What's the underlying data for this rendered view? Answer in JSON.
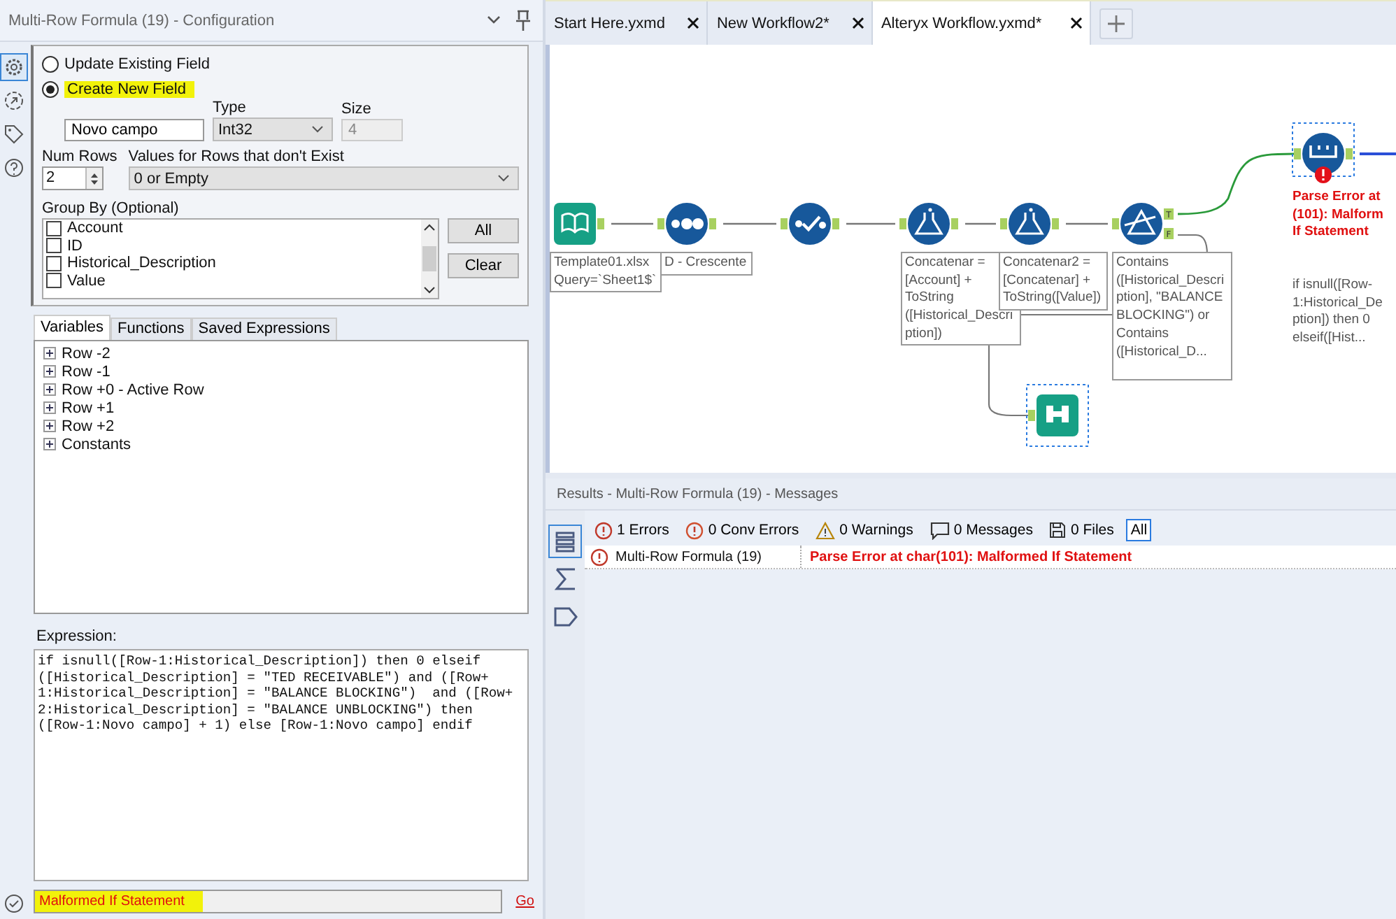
{
  "config_panel": {
    "title": "Multi-Row Formula (19) - Configuration",
    "side_icons": [
      {
        "kind": "settings",
        "selected": true
      },
      {
        "kind": "connection",
        "selected": false
      },
      {
        "kind": "tag",
        "selected": false
      },
      {
        "kind": "help",
        "selected": false
      }
    ],
    "field_mode": [
      {
        "label": "Update Existing Field",
        "selected": false,
        "highlighted": false
      },
      {
        "label": "Create New  Field",
        "selected": true,
        "highlighted": true
      }
    ],
    "new_field": {
      "value": "Novo campo",
      "type_label": "Type",
      "type_value": "Int32",
      "size_label": "Size",
      "size_value": "4"
    },
    "num_rows": {
      "label": "Num Rows",
      "value": "2"
    },
    "missing_rows": {
      "label": "Values for Rows that don't Exist",
      "value": "0 or Empty"
    },
    "group_by": {
      "label": "Group By (Optional)",
      "items": [
        {
          "label": "Account",
          "checked": false
        },
        {
          "label": "ID",
          "checked": false
        },
        {
          "label": "Historical_Description",
          "checked": false
        },
        {
          "label": "Value",
          "checked": false
        }
      ],
      "buttons": [
        "All",
        "Clear"
      ]
    },
    "expression_tabs": [
      {
        "label": "Variables",
        "selected": true
      },
      {
        "label": "Functions",
        "selected": false
      },
      {
        "label": "Saved Expressions",
        "selected": false
      }
    ],
    "variables": [
      {
        "label": "Row -2",
        "expanded": false
      },
      {
        "label": "Row -1",
        "expanded": false
      },
      {
        "label": "Row +0 - Active Row",
        "expanded": false
      },
      {
        "label": "Row +1",
        "expanded": false
      },
      {
        "label": "Row +2",
        "expanded": false
      },
      {
        "label": "Constants",
        "expanded": false
      }
    ],
    "expression": {
      "label": "Expression:",
      "lines": [
        "if isnull([Row-1:Historical_Description]) then 0 elseif",
        "([Historical_Description] = \"TED RECEIVABLE\") and ([Row+",
        "1:Historical_Description] = \"BALANCE BLOCKING\")  and ([Row+",
        "2:Historical_Description] = \"BALANCE UNBLOCKING\") then",
        "([Row-1:Novo campo] + 1) else [Row-1:Novo campo] endif"
      ]
    },
    "status": {
      "message": "Malformed If Statement",
      "highlighted": true,
      "link": "Go"
    }
  },
  "workflow_tabs": [
    {
      "label": "Start Here.yxmd",
      "selected": false
    },
    {
      "label": "New Workflow2*",
      "selected": false
    },
    {
      "label": "Alteryx Workflow.yxmd*",
      "selected": true
    }
  ],
  "canvas": {
    "nodes": [
      {
        "kind": "input",
        "selected": false,
        "error": false,
        "annotation": "Template01.xlsx\nQuery=`Sheet1$`"
      },
      {
        "kind": "record_id",
        "selected": false,
        "error": false,
        "annotation": "D - Crescente"
      },
      {
        "kind": "select",
        "selected": false,
        "error": false
      },
      {
        "kind": "formula",
        "selected": false,
        "error": false,
        "annotation": "Concatenar =\n[Account] +\nToString\n([Historical_Descri\nption])"
      },
      {
        "kind": "formula",
        "selected": false,
        "error": false,
        "annotation": "Concatenar2 =\n[Concatenar] +\nToString([Value])"
      },
      {
        "kind": "filter",
        "selected": false,
        "error": false,
        "outputs": [
          "T",
          "F"
        ],
        "annotation": "Contains\n([Historical_Descri\nption], \"BALANCE\nBLOCKING\") or\nContains\n([Historical_D..."
      },
      {
        "kind": "multi_row",
        "selected": true,
        "error": true,
        "error_text": "Parse Error at\n(101): Malform\nIf Statement",
        "annotation": "if isnull([Row-\n1:Historical_De\nption]) then 0\nelseif([Hist..."
      },
      {
        "kind": "browse",
        "selected": true,
        "error": false
      }
    ]
  },
  "results": {
    "title": "Results - Multi-Row Formula (19) - Messages",
    "side_icons": [
      {
        "kind": "list",
        "selected": true
      },
      {
        "kind": "sigma",
        "selected": false
      },
      {
        "kind": "tag",
        "selected": false
      }
    ],
    "filters": [
      {
        "kind": "error",
        "label": "1 Errors",
        "selected": false
      },
      {
        "kind": "conv_error",
        "label": "0 Conv Errors",
        "selected": false
      },
      {
        "kind": "warning",
        "label": "0 Warnings",
        "selected": false
      },
      {
        "kind": "message",
        "label": "0 Messages",
        "selected": false
      },
      {
        "kind": "file",
        "label": "0 Files",
        "selected": false
      },
      {
        "kind": "all",
        "label": "All",
        "selected": true
      }
    ],
    "messages": [
      {
        "kind": "error",
        "tool": "Multi-Row Formula (19)",
        "text": "Parse Error at char(101): Malformed If Statement"
      }
    ]
  }
}
